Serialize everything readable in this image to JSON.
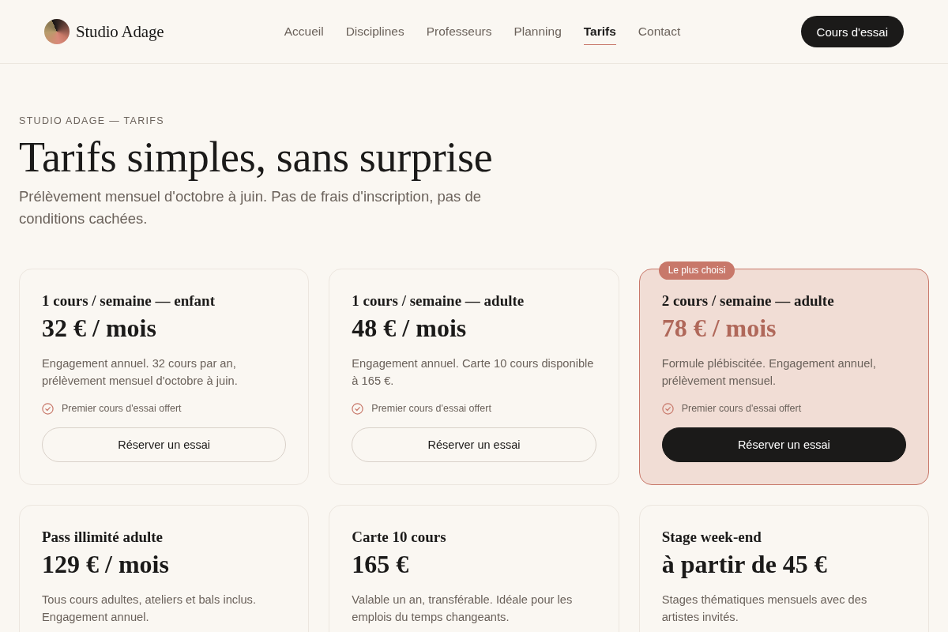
{
  "header": {
    "brand": "Studio Adage",
    "nav": [
      {
        "label": "Accueil",
        "selected": false
      },
      {
        "label": "Disciplines",
        "selected": false
      },
      {
        "label": "Professeurs",
        "selected": false
      },
      {
        "label": "Planning",
        "selected": false
      },
      {
        "label": "Tarifs",
        "selected": true
      },
      {
        "label": "Contact",
        "selected": false
      }
    ],
    "cta": "Cours d'essai"
  },
  "hero": {
    "eyebrow": "STUDIO ADAGE — TARIFS",
    "title": "Tarifs simples, sans surprise",
    "subtitle": "Prélèvement mensuel d'octobre à juin. Pas de frais d'inscription, pas de conditions cachées."
  },
  "plans": [
    {
      "name": "1 cours / semaine — enfant",
      "price": "32 € / mois",
      "description": "Engagement annuel. 32 cours par an, prélèvement mensuel d'octobre à juin.",
      "perk": "Premier cours d'essai offert",
      "button": "Réserver un essai",
      "featured": false
    },
    {
      "name": "1 cours / semaine — adulte",
      "price": "48 € / mois",
      "description": "Engagement annuel. Carte 10 cours disponible à 165 €.",
      "perk": "Premier cours d'essai offert",
      "button": "Réserver un essai",
      "featured": false
    },
    {
      "name": "2 cours / semaine — adulte",
      "price": "78 € / mois",
      "description": "Formule plébiscitée. Engagement annuel, prélèvement mensuel.",
      "perk": "Premier cours d'essai offert",
      "button": "Réserver un essai",
      "featured": true,
      "badge": "Le plus choisi"
    },
    {
      "name": "Pass illimité adulte",
      "price": "129 € / mois",
      "description": "Tous cours adultes, ateliers et bals inclus. Engagement annuel.",
      "featured": false
    },
    {
      "name": "Carte 10 cours",
      "price": "165 €",
      "description": "Valable un an, transférable. Idéale pour les emplois du temps changeants.",
      "featured": false
    },
    {
      "name": "Stage week-end",
      "price": "à partir de 45 €",
      "description": "Stages thématiques mensuels avec des artistes invités.",
      "featured": false
    }
  ]
}
